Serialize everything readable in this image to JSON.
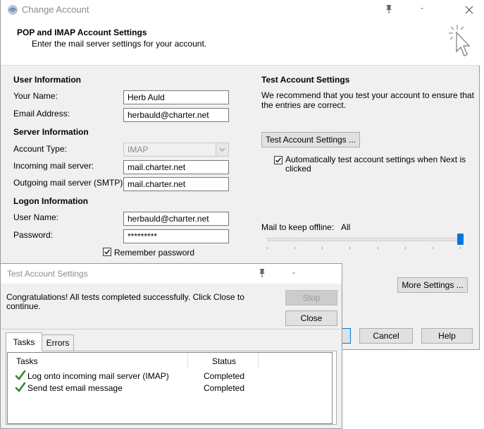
{
  "main_dialog": {
    "title": "Change Account",
    "header": {
      "title": "POP and IMAP Account Settings",
      "subtitle": "Enter the mail server settings for your account."
    },
    "user_info": {
      "heading": "User Information",
      "name_label": "Your Name:",
      "name_value": "Herb Auld",
      "email_label": "Email Address:",
      "email_value": "herbauld@charter.net"
    },
    "server_info": {
      "heading": "Server Information",
      "account_type_label": "Account Type:",
      "account_type_value": "IMAP",
      "incoming_label": "Incoming mail server:",
      "incoming_value": "mail.charter.net",
      "outgoing_label": "Outgoing mail server (SMTP):",
      "outgoing_value": "mail.charter.net"
    },
    "logon_info": {
      "heading": "Logon Information",
      "username_label": "User Name:",
      "username_value": "herbauld@charter.net",
      "password_label": "Password:",
      "password_value": "*********",
      "remember_label": "Remember password"
    },
    "test_settings": {
      "heading": "Test Account Settings",
      "description": "We recommend that you test your account to ensure that the entries are correct.",
      "button_label": "Test Account Settings ...",
      "auto_test_label": "Automatically test account settings when Next is clicked"
    },
    "offline": {
      "label": "Mail to keep offline:",
      "value": "All",
      "slider_level": 1.0
    },
    "more_settings_label": "More Settings ...",
    "footer": {
      "cancel_label": "Cancel",
      "help_label": "Help"
    }
  },
  "test_dialog": {
    "title": "Test Account Settings",
    "message": "Congratulations! All tests completed successfully. Click Close to continue.",
    "stop_label": "Stop",
    "close_label": "Close",
    "tabs": [
      {
        "label": "Tasks"
      },
      {
        "label": "Errors"
      }
    ],
    "columns": {
      "tasks": "Tasks",
      "status": "Status"
    },
    "rows": [
      {
        "task": "Log onto incoming mail server (IMAP)",
        "status": "Completed"
      },
      {
        "task": "Send test email message",
        "status": "Completed"
      }
    ]
  },
  "colors": {
    "accent": "#0078d7",
    "check_green": "#2f8a2f",
    "dialog_bg": "#f0f0f0"
  }
}
